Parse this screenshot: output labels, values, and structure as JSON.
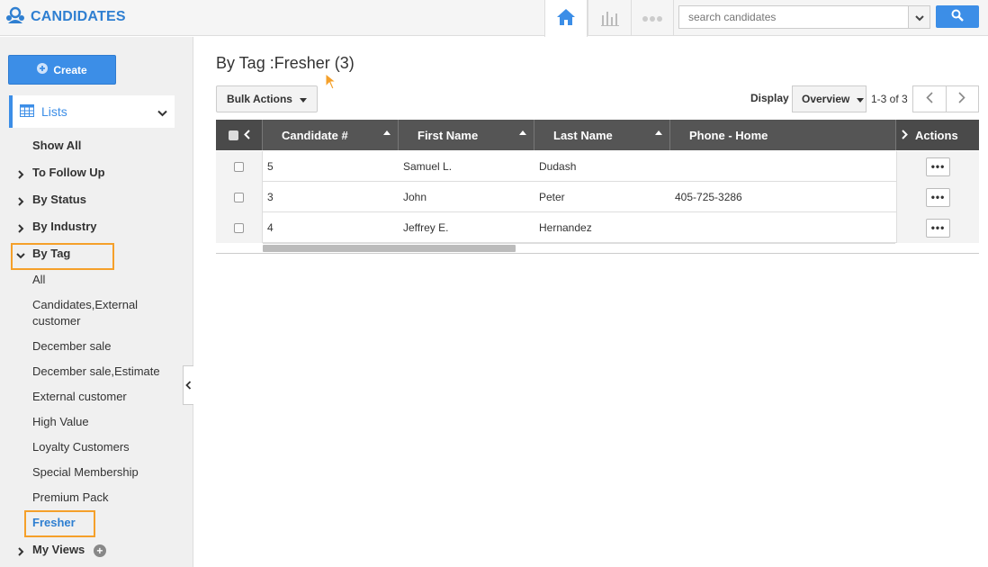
{
  "header": {
    "app_title": "CANDIDATES",
    "search_placeholder": "search candidates"
  },
  "sidebar": {
    "create_label": "Create",
    "lists_label": "Lists",
    "items": [
      {
        "label": "Show All"
      },
      {
        "label": "To Follow Up"
      },
      {
        "label": "By Status"
      },
      {
        "label": "By Industry"
      },
      {
        "label": "By Tag"
      }
    ],
    "tags": [
      "All",
      "Candidates,External customer",
      "December sale",
      "December sale,Estimate",
      "External customer",
      "High Value",
      "Loyalty Customers",
      "Special Membership",
      "Premium Pack",
      "Fresher"
    ],
    "my_views_label": "My Views"
  },
  "main": {
    "title": "By Tag :Fresher (3)",
    "bulk_actions_label": "Bulk Actions",
    "display_label": "Display",
    "display_value": "Overview",
    "count_text": "1-3 of 3"
  },
  "table": {
    "columns": [
      "Candidate #",
      "First Name",
      "Last Name",
      "Phone - Home",
      "Actions"
    ],
    "rows": [
      {
        "candidate": "5",
        "first": "Samuel L.",
        "last": "Dudash",
        "phone": ""
      },
      {
        "candidate": "3",
        "first": "John",
        "last": "Peter",
        "phone": "405-725-3286"
      },
      {
        "candidate": "4",
        "first": "Jeffrey E.",
        "last": "Hernandez",
        "phone": ""
      }
    ],
    "actions_glyph": "•••"
  },
  "colors": {
    "accent": "#3c8ee7",
    "brand": "#2f7fd1",
    "highlight": "#f5a02a",
    "table_header": "#555555"
  }
}
